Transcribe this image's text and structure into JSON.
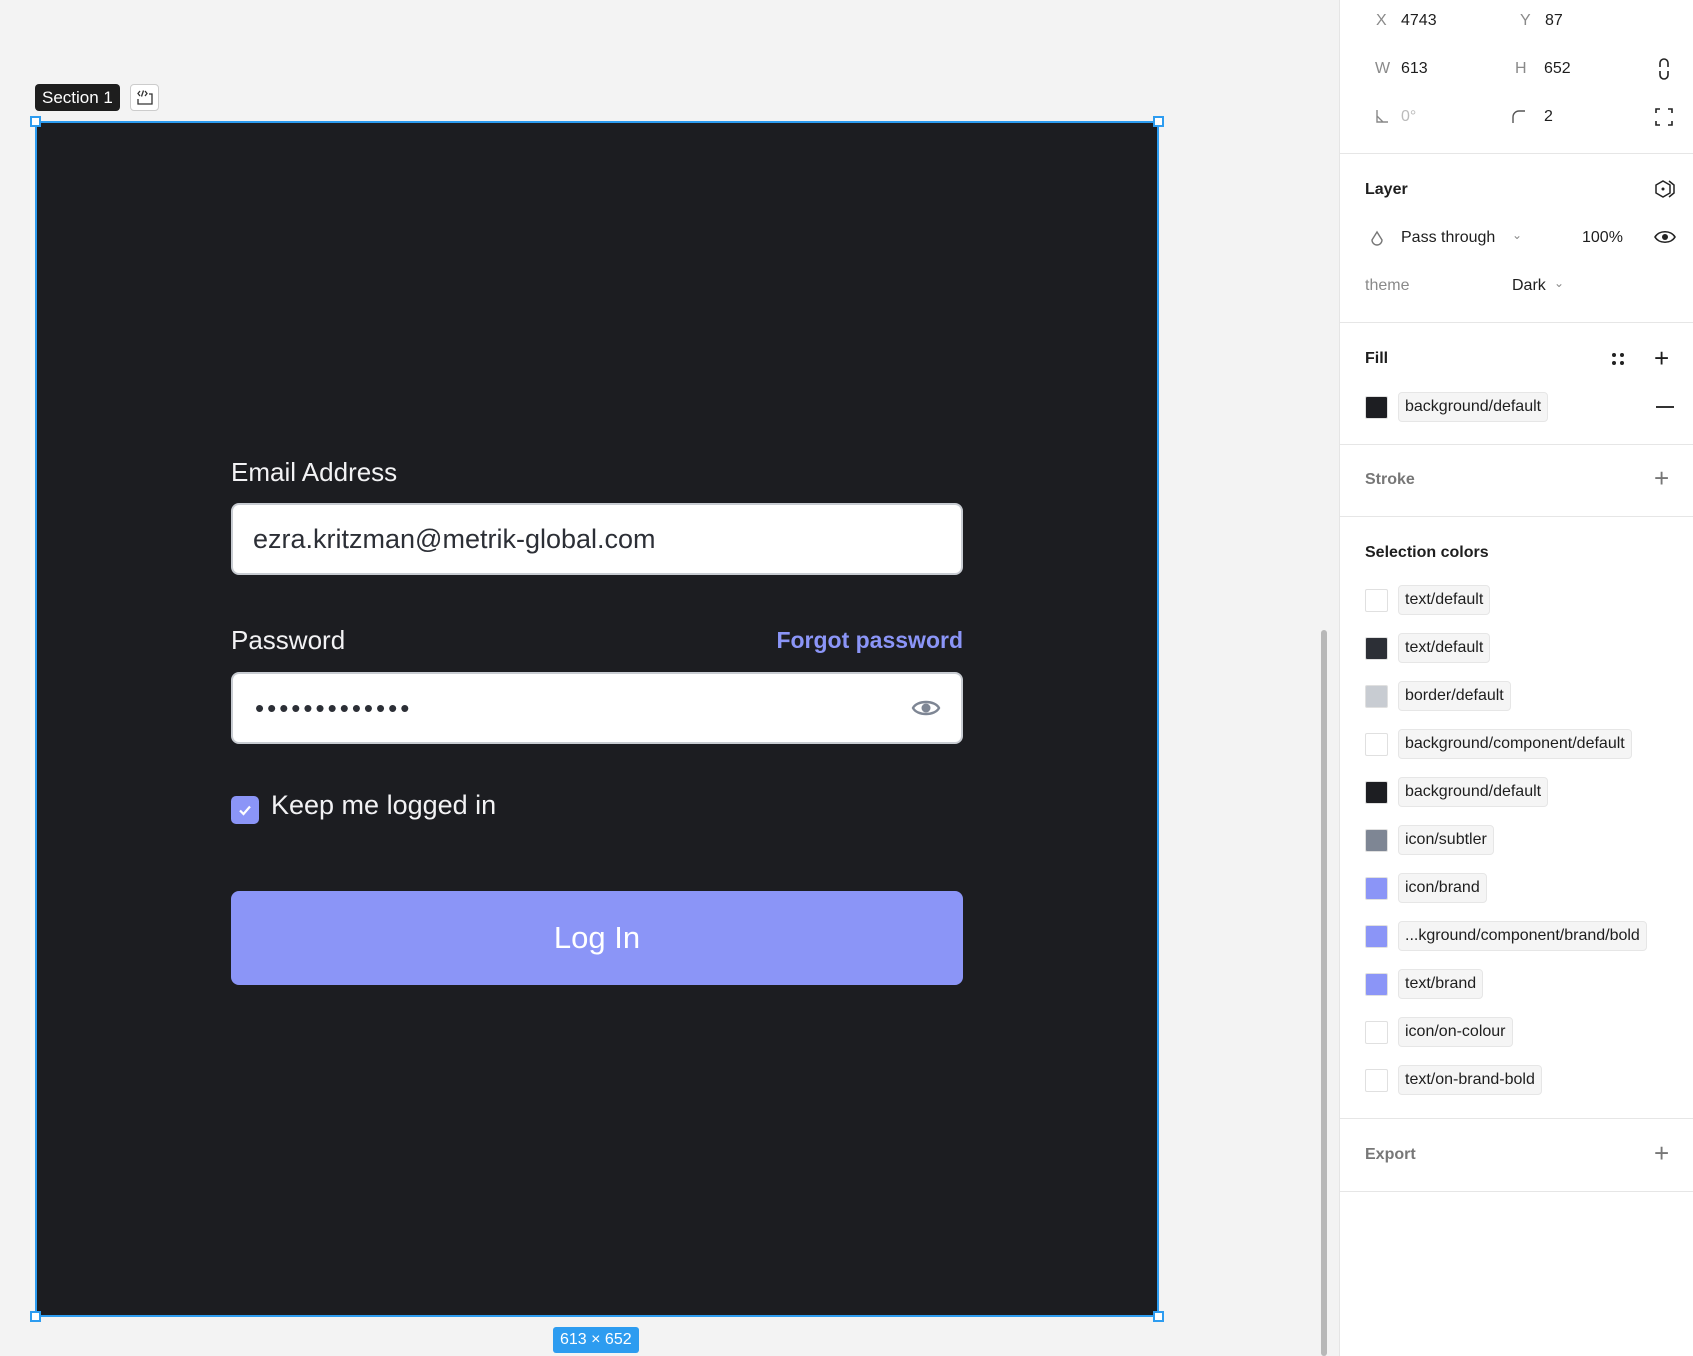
{
  "canvas": {
    "section_label": "Section 1",
    "size_badge": "613 × 652"
  },
  "form": {
    "email_label": "Email Address",
    "email_value": "ezra.kritzman@metrik-global.com",
    "password_label": "Password",
    "forgot_link": "Forgot password",
    "password_masked": "•••••••••••••",
    "keep_logged_in": "Keep me logged in",
    "keep_logged_in_checked": true,
    "login_button": "Log In"
  },
  "panel": {
    "x_label": "X",
    "x_value": "4743",
    "y_label": "Y",
    "y_value": "87",
    "w_label": "W",
    "w_value": "613",
    "h_label": "H",
    "h_value": "652",
    "rotation": "0°",
    "radius": "2",
    "layer": {
      "title": "Layer",
      "blend": "Pass through",
      "opacity": "100%",
      "theme_label": "theme",
      "theme_value": "Dark"
    },
    "fill": {
      "title": "Fill",
      "items": [
        {
          "name": "background/default",
          "color": "#1d1e22"
        }
      ]
    },
    "stroke": {
      "title": "Stroke"
    },
    "selection_colors": {
      "title": "Selection colors",
      "items": [
        {
          "name": "text/default",
          "color": "#ffffff"
        },
        {
          "name": "text/default",
          "color": "#2c2f36"
        },
        {
          "name": "border/default",
          "color": "#c8ccd2"
        },
        {
          "name": "background/component/default",
          "color": "#ffffff"
        },
        {
          "name": "background/default",
          "color": "#1d1e22"
        },
        {
          "name": "icon/subtler",
          "color": "#7e8694"
        },
        {
          "name": "icon/brand",
          "color": "#8b95f7"
        },
        {
          "name": "...kground/component/brand/bold",
          "color": "#8b95f7"
        },
        {
          "name": "text/brand",
          "color": "#8b95f7"
        },
        {
          "name": "icon/on-colour",
          "color": "#ffffff"
        },
        {
          "name": "text/on-brand-bold",
          "color": "#ffffff"
        }
      ]
    },
    "export": {
      "title": "Export"
    }
  },
  "colors": {
    "brand": "#8b95f7",
    "background": "#1c1d21",
    "selection": "#2d9cf0"
  }
}
